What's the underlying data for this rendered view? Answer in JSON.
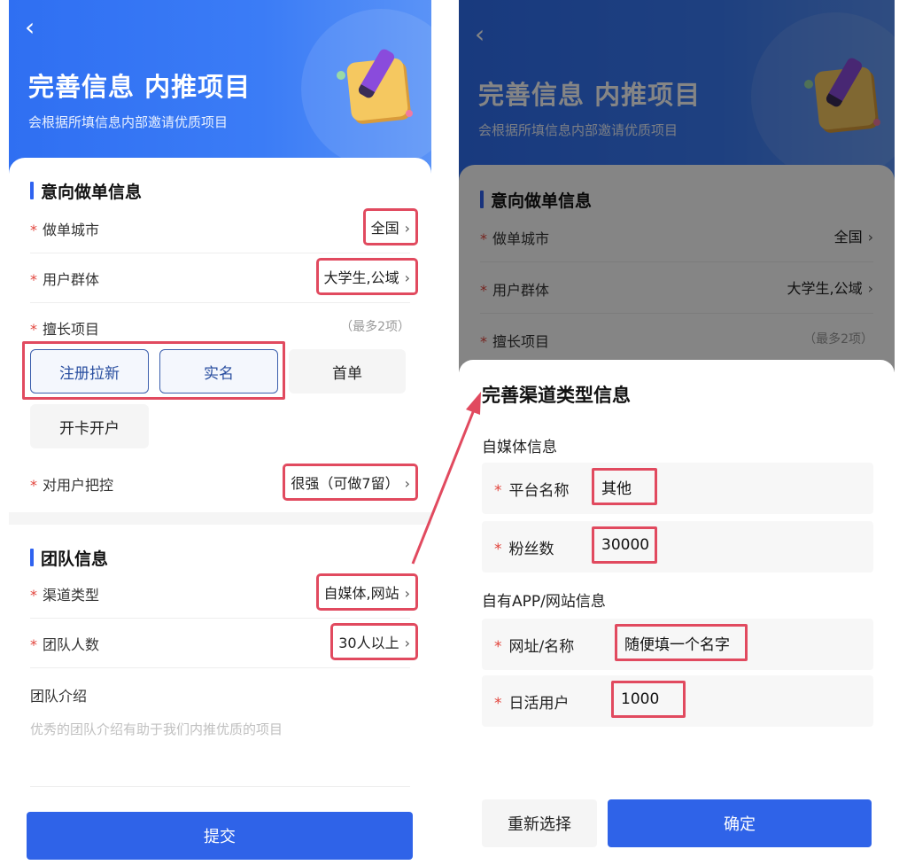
{
  "left": {
    "back_icon": "chevron-left-icon",
    "title": "完善信息 内推项目",
    "subtitle": "会根据所填信息内部邀请优质项目",
    "intent_section": {
      "title": "意向做单信息",
      "city": {
        "label": "做单城市",
        "value": "全国"
      },
      "user_group": {
        "label": "用户群体",
        "value": "大学生,公域"
      },
      "skills": {
        "label": "擅长项目",
        "hint": "（最多2项）",
        "options": [
          "注册拉新",
          "实名",
          "首单",
          "开卡开户"
        ],
        "selected": [
          "注册拉新",
          "实名"
        ]
      },
      "control": {
        "label": "对用户把控",
        "value": "很强（可做7留）"
      }
    },
    "team_section": {
      "title": "团队信息",
      "channel": {
        "label": "渠道类型",
        "value": "自媒体,网站"
      },
      "size": {
        "label": "团队人数",
        "value": "30人以上"
      },
      "intro": {
        "label": "团队介绍",
        "placeholder": "优秀的团队介绍有助于我们内推优质的项目"
      }
    },
    "submit_label": "提交"
  },
  "right": {
    "back_icon": "chevron-left-icon",
    "title": "完善信息 内推项目",
    "subtitle": "会根据所填信息内部邀请优质项目",
    "behind": {
      "section_title": "意向做单信息",
      "city": {
        "label": "做单城市",
        "value": "全国"
      },
      "user_group": {
        "label": "用户群体",
        "value": "大学生,公域"
      },
      "skills": {
        "label": "擅长项目",
        "hint": "（最多2项）"
      }
    },
    "sheet": {
      "title": "完善渠道类型信息",
      "media_group": "自媒体信息",
      "platform": {
        "label": "平台名称",
        "value": "其他"
      },
      "fans": {
        "label": "粉丝数",
        "value": "30000"
      },
      "app_group": "自有APP/网站信息",
      "site": {
        "label": "网址/名称",
        "value": "随便填一个名字"
      },
      "dau": {
        "label": "日活用户",
        "value": "1000"
      },
      "reset_label": "重新选择",
      "confirm_label": "确定"
    }
  },
  "colors": {
    "primary": "#2f63e8",
    "highlight_box": "#e14a5f",
    "required_star": "#e2443c"
  }
}
